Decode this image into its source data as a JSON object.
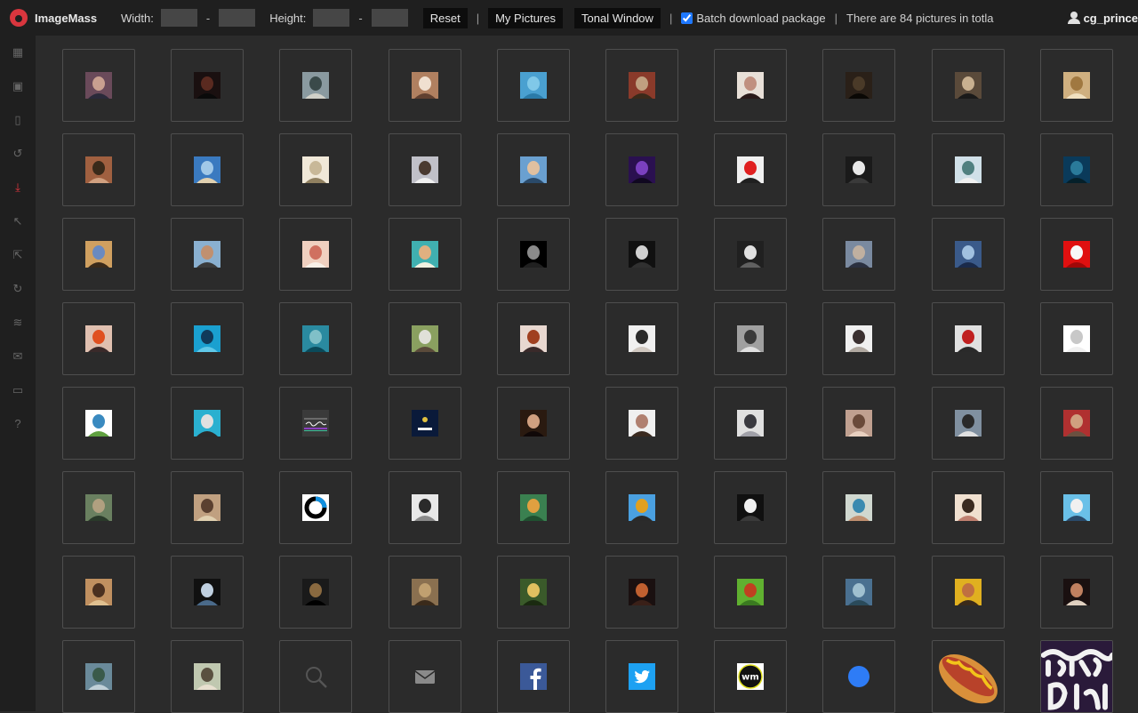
{
  "app": {
    "name": "ImageMass"
  },
  "toolbar": {
    "width_label": "Width:",
    "height_label": "Height:",
    "width_min": "",
    "width_max": "",
    "height_min": "",
    "height_max": "",
    "dash": "-",
    "reset_label": "Reset",
    "separator": "|",
    "my_pictures_label": "My Pictures",
    "tonal_window_label": "Tonal Window",
    "batch_label": "Batch download package",
    "batch_checked": true,
    "count_text": "There are 84 pictures in totla"
  },
  "user": {
    "name": "cg_prince"
  },
  "sidebar": {
    "items": [
      {
        "icon": "grid-icon",
        "glyph": "▦"
      },
      {
        "icon": "image-icon",
        "glyph": "▣"
      },
      {
        "icon": "document-icon",
        "glyph": "▯"
      },
      {
        "icon": "history-icon",
        "glyph": "↺"
      },
      {
        "icon": "download-icon",
        "glyph": "⤓",
        "active": true
      },
      {
        "icon": "cursor-icon",
        "glyph": "↖"
      },
      {
        "icon": "cursor-select-icon",
        "glyph": "⇱"
      },
      {
        "icon": "refresh-icon",
        "glyph": "↻"
      },
      {
        "icon": "layers-icon",
        "glyph": "≋"
      },
      {
        "icon": "mail-icon",
        "glyph": "✉"
      },
      {
        "icon": "chat-icon",
        "glyph": "▭"
      },
      {
        "icon": "help-icon",
        "glyph": "?"
      }
    ]
  },
  "images": [
    {
      "name": "photo-man-portrait",
      "colors": [
        "#6a4a5a",
        "#c9a090",
        "#2a2a3a"
      ]
    },
    {
      "name": "photo-dark-portrait",
      "colors": [
        "#1a1010",
        "#5a2a20",
        "#0a0a0a"
      ]
    },
    {
      "name": "photo-person-outdoor",
      "colors": [
        "#8a9aa0",
        "#3a4a4a",
        "#d0d0c8"
      ]
    },
    {
      "name": "photo-man-cap",
      "colors": [
        "#b08060",
        "#f0e0d0",
        "#604030"
      ]
    },
    {
      "name": "photo-sea-horizon",
      "colors": [
        "#4aa0d0",
        "#80c8e8",
        "#2a7aa8"
      ]
    },
    {
      "name": "photo-woman-red",
      "colors": [
        "#8a3a2a",
        "#c0a080",
        "#3a2a1a"
      ]
    },
    {
      "name": "photo-couple",
      "colors": [
        "#e8e0d8",
        "#c09080",
        "#2a1a1a"
      ]
    },
    {
      "name": "photo-dark-room",
      "colors": [
        "#2a2018",
        "#4a3a28",
        "#0a0805"
      ]
    },
    {
      "name": "photo-camera-man",
      "colors": [
        "#5a4a3a",
        "#c8b090",
        "#1a1a1a"
      ]
    },
    {
      "name": "photo-wood-cafe",
      "colors": [
        "#d0b080",
        "#a07840",
        "#f0e0c0"
      ]
    },
    {
      "name": "photo-man-bearded",
      "colors": [
        "#a06040",
        "#3a2a1a",
        "#d0a080"
      ]
    },
    {
      "name": "photo-beach-sky",
      "colors": [
        "#3a7ac0",
        "#a0c8e8",
        "#e0d0b0"
      ]
    },
    {
      "name": "photo-bright-portrait",
      "colors": [
        "#f0e8d8",
        "#c8b898",
        "#908060"
      ]
    },
    {
      "name": "photo-man-glasses",
      "colors": [
        "#c0c0c8",
        "#4a3a30",
        "#f0f0f0"
      ]
    },
    {
      "name": "photo-man-sky",
      "colors": [
        "#6aa0d0",
        "#e0c0a0",
        "#2a4a6a"
      ]
    },
    {
      "name": "photo-purple-nebula",
      "colors": [
        "#2a1050",
        "#7a40c0",
        "#100820"
      ]
    },
    {
      "name": "photo-red-cartoon",
      "colors": [
        "#f0f0f0",
        "#e02020",
        "#202020"
      ]
    },
    {
      "name": "photo-woman-hair",
      "colors": [
        "#1a1a1a",
        "#e8e8e8",
        "#3a3a3a"
      ]
    },
    {
      "name": "photo-illustration",
      "colors": [
        "#d0e0e8",
        "#508080",
        "#f0f0f0"
      ]
    },
    {
      "name": "photo-underwater-blue",
      "colors": [
        "#0a3a5a",
        "#2a7a9a",
        "#05202a"
      ]
    },
    {
      "name": "photo-man-outdoor",
      "colors": [
        "#d0a060",
        "#6a8ac0",
        "#3a2a1a"
      ]
    },
    {
      "name": "photo-group-beach",
      "colors": [
        "#8ab0d0",
        "#c09070",
        "#3a3a3a"
      ]
    },
    {
      "name": "photo-girl-bright",
      "colors": [
        "#f0d0c0",
        "#d07060",
        "#f8f0e8"
      ]
    },
    {
      "name": "photo-dog-sand",
      "colors": [
        "#40b0b0",
        "#e0b080",
        "#f0f0e0"
      ]
    },
    {
      "name": "photo-dark-face",
      "colors": [
        "#000000",
        "#8a8a8a",
        "#202020"
      ]
    },
    {
      "name": "photo-dark-window",
      "colors": [
        "#101010",
        "#d0d0d0",
        "#303030"
      ]
    },
    {
      "name": "photo-zebra-stripes",
      "colors": [
        "#202020",
        "#e0e0e0",
        "#606060"
      ]
    },
    {
      "name": "photo-man-grey",
      "colors": [
        "#7a8aa0",
        "#c0b0a0",
        "#2a3040"
      ]
    },
    {
      "name": "photo-blue-action",
      "colors": [
        "#3a5a8a",
        "#a0c0e0",
        "#1a2a4a"
      ]
    },
    {
      "name": "photo-red-logo",
      "colors": [
        "#e01010",
        "#f8f8f8",
        "#a00808"
      ]
    },
    {
      "name": "photo-woman-orange",
      "colors": [
        "#e0c0b0",
        "#e05020",
        "#3a2a2a"
      ]
    },
    {
      "name": "photo-diver-blue",
      "colors": [
        "#1aa0d0",
        "#103a5a",
        "#60c8e8"
      ]
    },
    {
      "name": "photo-underwater-dive",
      "colors": [
        "#2a8aa0",
        "#80c0c8",
        "#0a4a5a"
      ]
    },
    {
      "name": "photo-old-man",
      "colors": [
        "#8aa060",
        "#e0e0d8",
        "#5a4a3a"
      ]
    },
    {
      "name": "photo-woman-pose",
      "colors": [
        "#e8d8d0",
        "#a04020",
        "#3a2a2a"
      ]
    },
    {
      "name": "photo-man-standing",
      "colors": [
        "#f0f0f0",
        "#2a2a2a",
        "#d0c8c0"
      ]
    },
    {
      "name": "photo-people-monochrome",
      "colors": [
        "#a0a0a0",
        "#3a3a3a",
        "#e0e0e0"
      ]
    },
    {
      "name": "photo-woman-sketch",
      "colors": [
        "#f0f0f0",
        "#3a3030",
        "#b0a8a0"
      ]
    },
    {
      "name": "photo-man-red",
      "colors": [
        "#e0e0e0",
        "#c02020",
        "#2a2a2a"
      ]
    },
    {
      "name": "photo-sketch-face",
      "colors": [
        "#ffffff",
        "#c8c8c8",
        "#f0f0f0"
      ]
    },
    {
      "name": "photo-tree-circle",
      "colors": [
        "#ffffff",
        "#3a8ac0",
        "#60a040"
      ]
    },
    {
      "name": "photo-people-sea",
      "colors": [
        "#2ab0d0",
        "#e0e0e0",
        "#2a2a2a"
      ]
    },
    {
      "name": "logo-signature",
      "colors": [
        "#3a3a3a",
        "#ffffff",
        "#8a40c0"
      ]
    },
    {
      "name": "logo-kaka",
      "colors": [
        "#0a1a3a",
        "#f0f0f0",
        "#e0c040"
      ]
    },
    {
      "name": "photo-woman-dark",
      "colors": [
        "#2a1a10",
        "#d0a080",
        "#100808"
      ]
    },
    {
      "name": "photo-man-old",
      "colors": [
        "#f0f0f0",
        "#b08070",
        "#3a2a20"
      ]
    },
    {
      "name": "photo-boy-glasses",
      "colors": [
        "#e0e0e0",
        "#3a3a40",
        "#a0a0a8"
      ]
    },
    {
      "name": "photo-woman-smile",
      "colors": [
        "#c0a090",
        "#6a4a3a",
        "#e8d0c0"
      ]
    },
    {
      "name": "photo-man-city",
      "colors": [
        "#8090a0",
        "#2a2a2a",
        "#e0e0e0"
      ]
    },
    {
      "name": "photo-cat",
      "colors": [
        "#b03030",
        "#d0a080",
        "#6a5040"
      ]
    },
    {
      "name": "photo-forest-hike",
      "colors": [
        "#6a8060",
        "#b0a080",
        "#2a3a2a"
      ]
    },
    {
      "name": "photo-dog-rocks",
      "colors": [
        "#c0a080",
        "#5a4030",
        "#e0d0b0"
      ]
    },
    {
      "name": "icon-ring",
      "colors": [
        "#ffffff",
        "#1090e0",
        "#000000"
      ]
    },
    {
      "name": "photo-man-bw",
      "colors": [
        "#e8e8e8",
        "#2a2a2a",
        "#8a8a8a"
      ]
    },
    {
      "name": "photo-palm-leaf",
      "colors": [
        "#3a8050",
        "#e0a040",
        "#205030"
      ]
    },
    {
      "name": "photo-man-yellow",
      "colors": [
        "#4aa0e0",
        "#e0a020",
        "#2a2a2a"
      ]
    },
    {
      "name": "photo-man-cap-dark",
      "colors": [
        "#101010",
        "#f0f0f0",
        "#3a3a3a"
      ]
    },
    {
      "name": "photo-woman-water",
      "colors": [
        "#d0d8d0",
        "#3a8ab0",
        "#c09070"
      ]
    },
    {
      "name": "photo-man-asian",
      "colors": [
        "#f0e0d0",
        "#3a2a20",
        "#c08070"
      ]
    },
    {
      "name": "photo-snow-run",
      "colors": [
        "#6ac0e8",
        "#f0f0f0",
        "#2a4a6a"
      ]
    },
    {
      "name": "photo-building-arch",
      "colors": [
        "#c09060",
        "#4a3020",
        "#e0c090"
      ]
    },
    {
      "name": "photo-man-helmet",
      "colors": [
        "#101010",
        "#c0d0e0",
        "#4a6a8a"
      ]
    },
    {
      "name": "photo-shoe-dark",
      "colors": [
        "#1a1a1a",
        "#8a6a40",
        "#000000"
      ]
    },
    {
      "name": "photo-people-group",
      "colors": [
        "#8a7050",
        "#c0a070",
        "#3a2a1a"
      ]
    },
    {
      "name": "photo-woman-forest",
      "colors": [
        "#3a5a2a",
        "#e0c060",
        "#1a2a10"
      ]
    },
    {
      "name": "photo-man-sunglasses",
      "colors": [
        "#1a1010",
        "#c06030",
        "#3a2018"
      ]
    },
    {
      "name": "photo-green-bird",
      "colors": [
        "#60b030",
        "#c04020",
        "#3a7a20"
      ]
    },
    {
      "name": "photo-lake-landscape",
      "colors": [
        "#4a7090",
        "#a0c0d0",
        "#2a4a5a"
      ]
    },
    {
      "name": "photo-man-yellow-bg",
      "colors": [
        "#e0b020",
        "#c07040",
        "#3a2a1a"
      ]
    },
    {
      "name": "photo-dinner-table",
      "colors": [
        "#1a1010",
        "#c08060",
        "#e0d0c0"
      ]
    },
    {
      "name": "photo-river-rocks",
      "colors": [
        "#6a8a9a",
        "#3a5a4a",
        "#c0d0d8"
      ]
    },
    {
      "name": "photo-woman-glasses",
      "colors": [
        "#c0c8b0",
        "#5a5040",
        "#e8e0d0"
      ]
    },
    {
      "name": "icon-search",
      "colors": [
        "#2b2b2b",
        "#555555",
        "#2b2b2b"
      ]
    },
    {
      "name": "icon-mail",
      "colors": [
        "#2b2b2b",
        "#8a8a8a",
        "#2b2b2b"
      ]
    },
    {
      "name": "icon-facebook",
      "colors": [
        "#3b5998",
        "#ffffff",
        "#3b5998"
      ]
    },
    {
      "name": "icon-twitter",
      "colors": [
        "#1da1f2",
        "#ffffff",
        "#1da1f2"
      ]
    },
    {
      "name": "icon-wm-logo",
      "colors": [
        "#ffffff",
        "#111111",
        "#e0e020"
      ]
    },
    {
      "name": "icon-blue-dot",
      "colors": [
        "#2b2b2b",
        "#2e7cf6",
        "#2b2b2b"
      ]
    },
    {
      "name": "image-hotdog",
      "colors": [
        "#2b2b2b",
        "#d08030",
        "#e03020"
      ]
    },
    {
      "name": "image-tasty-dinner-logo",
      "colors": [
        "#2a1a3a",
        "#f2f2f2",
        "#2a1a3a"
      ]
    }
  ]
}
